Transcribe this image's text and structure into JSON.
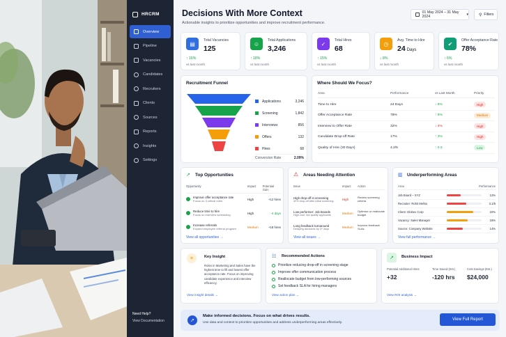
{
  "app": {
    "name": "HRCRM"
  },
  "sidebar": {
    "items": [
      {
        "label": "Overview",
        "icon": "grid-icon",
        "active": true
      },
      {
        "label": "Pipeline",
        "icon": "pipeline-icon"
      },
      {
        "label": "Vacancies",
        "icon": "briefcase-icon"
      },
      {
        "label": "Candidates",
        "icon": "users-icon"
      },
      {
        "label": "Recruiters",
        "icon": "user-icon"
      },
      {
        "label": "Clients",
        "icon": "building-icon"
      },
      {
        "label": "Sources",
        "icon": "globe-icon"
      },
      {
        "label": "Reports",
        "icon": "document-icon"
      },
      {
        "label": "Insights",
        "icon": "bulb-icon"
      },
      {
        "label": "Settings",
        "icon": "gear-icon"
      }
    ],
    "help_title": "Need Help?",
    "help_link": "View Documentation"
  },
  "header": {
    "title": "Decisions With More Context",
    "subtitle": "Actionable insights to prioritize opportunities and improve recruitment performance.",
    "date_range": "01 May 2024 – 31 May 2024",
    "filters_label": "Filters"
  },
  "kpis": [
    {
      "label": "Total Vacancies",
      "value": "125",
      "unit": "",
      "delta": "↑ 16%",
      "vs": "vs last month",
      "color": "#2f6fe0",
      "icon": "briefcase-icon"
    },
    {
      "label": "Total Applications",
      "value": "3,246",
      "unit": "",
      "delta": "↑ 18%",
      "vs": "vs last month",
      "color": "#16a34a",
      "icon": "users-icon"
    },
    {
      "label": "Total Hires",
      "value": "68",
      "unit": "",
      "delta": "↑ 15%",
      "vs": "vs last month",
      "color": "#7c3aed",
      "icon": "user-check-icon"
    },
    {
      "label": "Avg. Time to Hire",
      "value": "24",
      "unit": "Days",
      "delta": "↓ 8%",
      "vs": "vs last month",
      "color": "#f59e0b",
      "icon": "clock-icon"
    },
    {
      "label": "Offer Acceptance Rate",
      "value": "78%",
      "unit": "",
      "delta": "↑ 6%",
      "vs": "vs last month",
      "color": "#0f9d76",
      "icon": "check-icon"
    }
  ],
  "funnel": {
    "title": "Recruitment Funnel",
    "stages": [
      {
        "label": "Applications",
        "value": "3,246",
        "color": "#2563eb"
      },
      {
        "label": "Screening",
        "value": "1,842",
        "color": "#16a34a"
      },
      {
        "label": "Interviews",
        "value": "856",
        "color": "#7c3aed"
      },
      {
        "label": "Offers",
        "value": "132",
        "color": "#f59e0b"
      },
      {
        "label": "Hires",
        "value": "68",
        "color": "#ef4444"
      }
    ],
    "conversion_label": "Conversion Rate",
    "conversion_value": "2.09%"
  },
  "focus": {
    "title": "Where Should We Focus?",
    "headers": [
      "Area",
      "Performance",
      "vs Last Month",
      "Priority"
    ],
    "rows": [
      {
        "area": "Time to Hire",
        "perf": "24 Days",
        "delta": "↓ 8%",
        "dir": "up",
        "priority": "High",
        "level": "high"
      },
      {
        "area": "Offer Acceptance Rate",
        "perf": "78%",
        "delta": "↑ 6%",
        "dir": "up",
        "priority": "Medium",
        "level": "med"
      },
      {
        "area": "Interview to Offer Rate",
        "perf": "32%",
        "delta": "↓ 4%",
        "dir": "down",
        "priority": "High",
        "level": "high"
      },
      {
        "area": "Candidate Drop-off Rate",
        "perf": "17%",
        "delta": "↑ 3%",
        "dir": "up",
        "priority": "High",
        "level": "high"
      },
      {
        "area": "Quality of Hire (30 Days)",
        "perf": "4.2/5",
        "delta": "↑ 0.3",
        "dir": "up",
        "priority": "Low",
        "level": "low"
      }
    ]
  },
  "opportunities": {
    "title": "Top Opportunities",
    "headers": [
      "Opportunity",
      "Impact",
      "Potential Gain"
    ],
    "rows": [
      {
        "title": "Improve offer acceptance rate",
        "sub": "Focus on 3 critical roles",
        "impact": "High",
        "gain": "+12 hires",
        "gain_color": "#1f2937"
      },
      {
        "title": "Reduce time to hire",
        "sub": "Focus on interview scheduling",
        "impact": "High",
        "gain": "-4 days",
        "gain_color": "#16a34a"
      },
      {
        "title": "Increase referrals",
        "sub": "Expand employee referral program",
        "impact": "Medium",
        "gain": "+18 hires",
        "gain_color": "#1f2937"
      }
    ],
    "link": "View all opportunities →"
  },
  "attention": {
    "title": "Areas Needing Attention",
    "headers": [
      "Issue",
      "Impact",
      "Action"
    ],
    "rows": [
      {
        "title": "High drop-off in screening",
        "sub": "32% drop-off after initial screening",
        "impact": "High",
        "action": "Review screening criteria"
      },
      {
        "title": "Low performer: Job Boards",
        "sub": "High cost, low quality applicants",
        "impact": "Medium",
        "action": "Optimize or reallocate budget"
      },
      {
        "title": "Long feedback turnaround",
        "sub": "Delaying decisions by 4+ days",
        "impact": "Medium",
        "action": "Improve feedback SLAs"
      }
    ],
    "link": "View all issues →"
  },
  "underperforming": {
    "title": "Underperforming Areas",
    "headers": [
      "Area",
      "Performance"
    ],
    "rows": [
      {
        "label": "Job Board – XYZ",
        "value": "12%",
        "fraction": 0.4,
        "color": "#ef4444"
      },
      {
        "label": "Recruiter: Rohit Mehta",
        "value": "3.1/5",
        "fraction": 0.55,
        "color": "#ef4444"
      },
      {
        "label": "Client: Globex Corp",
        "value": "22%",
        "fraction": 0.75,
        "color": "#f59e0b"
      },
      {
        "label": "Vacancy: Sales Manager",
        "value": "18%",
        "fraction": 0.6,
        "color": "#f59e0b"
      },
      {
        "label": "Source: Company Website",
        "value": "14%",
        "fraction": 0.45,
        "color": "#ef4444"
      }
    ],
    "link": "View full performance →"
  },
  "insight": {
    "title": "Key Insight",
    "text": "Roles in Marketing and Sales have the highest time to fill and lowest offer acceptance rate. Focus on improving candidate experience and interview efficiency.",
    "link": "View insight details →"
  },
  "actions": {
    "title": "Recommended Actions",
    "items": [
      "Prioritize reducing drop-off in screening stage",
      "Improve offer communication process",
      "Reallocate budget from low-performing sources",
      "Set feedback SLA for hiring managers"
    ],
    "link": "View action plan →"
  },
  "impact": {
    "title": "Business Impact",
    "metrics": [
      {
        "label": "Potential Additional Hires",
        "value": "+32"
      },
      {
        "label": "Time Saved (Est.)",
        "value": "-120 hrs"
      },
      {
        "label": "Cost Savings (Est.)",
        "value": "$24,000"
      }
    ],
    "link": "View ROI analysis →"
  },
  "cta": {
    "title": "Make informed decisions. Focus on what drives results.",
    "subtitle": "Use data and context to prioritize opportunities and address underperforming areas effectively.",
    "button": "View Full Report"
  }
}
